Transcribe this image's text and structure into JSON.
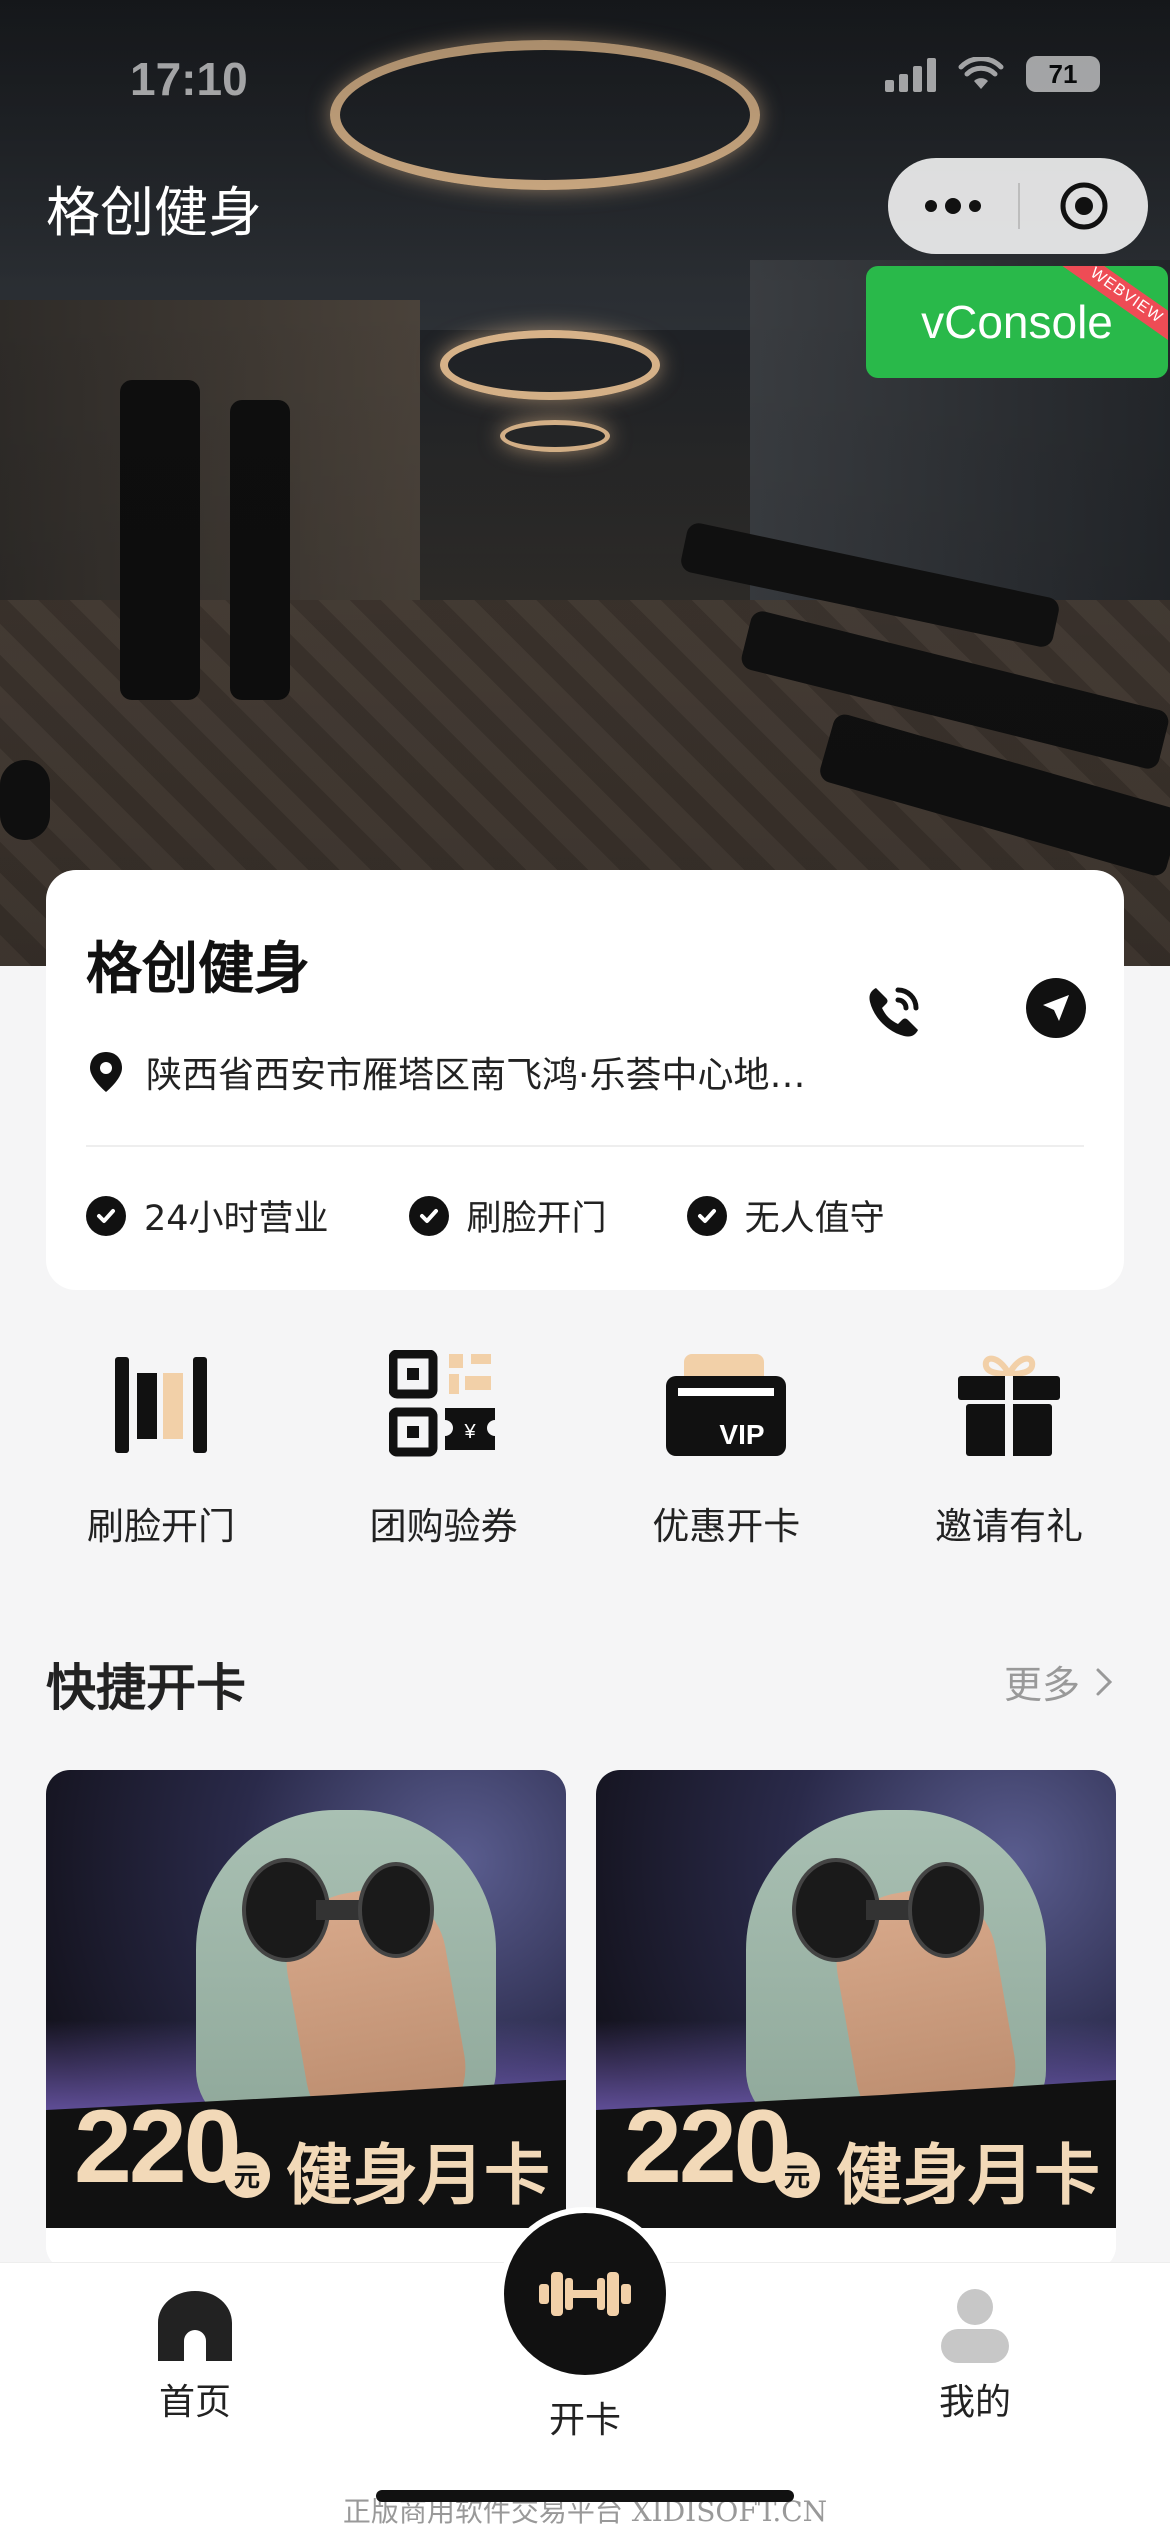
{
  "status_bar": {
    "time": "17:10",
    "battery": "71"
  },
  "nav": {
    "title": "格创健身"
  },
  "vconsole": {
    "label": "vConsole",
    "ribbon": "WEBVIEW"
  },
  "store": {
    "name": "格创健身",
    "address": "陕西省西安市雁塔区南飞鸿·乐荟中心地…",
    "features": [
      "24小时营业",
      "刷脸开门",
      "无人值守"
    ]
  },
  "actions": [
    {
      "label": "刷脸开门",
      "icon": "gate-icon"
    },
    {
      "label": "团购验券",
      "icon": "qr-coupon-icon"
    },
    {
      "label": "优惠开卡",
      "icon": "vip-card-icon"
    },
    {
      "label": "邀请有礼",
      "icon": "gift-icon"
    }
  ],
  "quick_cards": {
    "title": "快捷开卡",
    "more": "更多",
    "cards": [
      {
        "price": "220",
        "unit": "元",
        "name": "健身月卡"
      },
      {
        "price": "220",
        "unit": "元",
        "name": "健身月卡"
      }
    ]
  },
  "tabbar": {
    "home": "首页",
    "card": "开卡",
    "mine": "我的"
  },
  "watermark": "正版商用软件交易平台 XIDISOFT.CN",
  "colors": {
    "accent": "#111111",
    "gold": "#f2d9b8",
    "vconsole": "#29b94a",
    "background": "#f5f5f6"
  }
}
